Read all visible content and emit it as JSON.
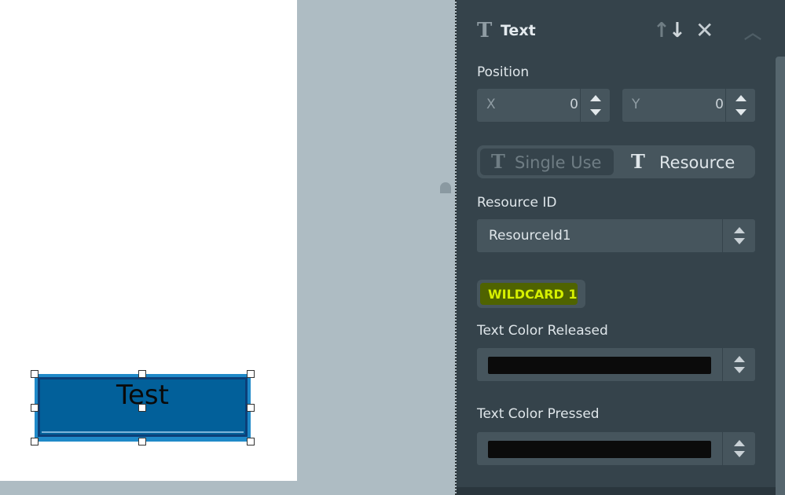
{
  "canvas": {
    "widget_text": "Test"
  },
  "panel": {
    "title": "Text",
    "icons": {
      "title": "text-format-icon",
      "move_up": "arrow-up-icon",
      "move_down": "arrow-down-icon",
      "close": "close-icon",
      "collapse": "chevron-up-icon"
    },
    "position": {
      "label": "Position",
      "x_label": "X",
      "x_value": "0",
      "y_label": "Y",
      "y_value": "0"
    },
    "text_mode": {
      "single_use_label": "Single Use",
      "resource_label": "Resource",
      "selected": "Resource"
    },
    "resource_id": {
      "label": "Resource ID",
      "value": "ResourceId1"
    },
    "wildcard_badge": "WILDCARD 1",
    "text_color_released": {
      "label": "Text Color Released",
      "color": "#0b0b0b"
    },
    "text_color_pressed": {
      "label": "Text Color Pressed",
      "color": "#0b0b0b"
    }
  },
  "colors": {
    "panel_bg": "#35434b",
    "field_bg": "#46555d",
    "widget_bg": "#02609a",
    "wildcard_text": "#d6f000"
  }
}
